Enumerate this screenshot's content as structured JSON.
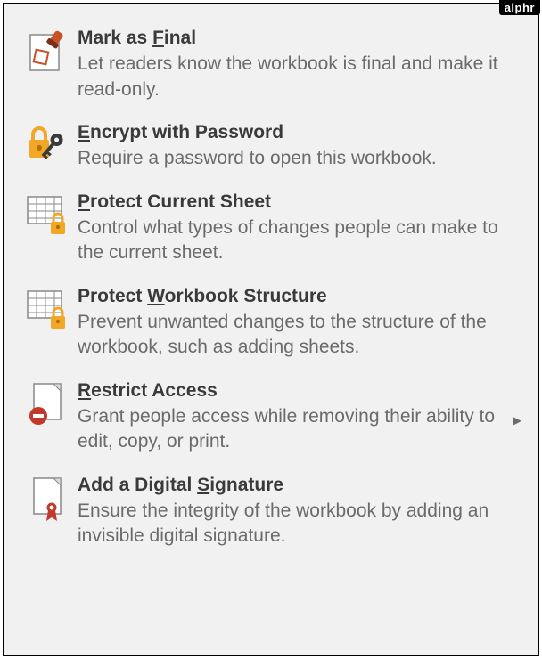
{
  "watermark": "alphr",
  "menu": {
    "items": [
      {
        "id": "mark-as-final",
        "title_pre": "Mark as ",
        "title_mnemonic": "F",
        "title_post": "inal",
        "desc": "Let readers know the workbook is final and make it read-only.",
        "has_submenu": false
      },
      {
        "id": "encrypt-with-password",
        "title_pre": "",
        "title_mnemonic": "E",
        "title_post": "ncrypt with Password",
        "desc": "Require a password to open this workbook.",
        "has_submenu": false
      },
      {
        "id": "protect-current-sheet",
        "title_pre": "",
        "title_mnemonic": "P",
        "title_post": "rotect Current Sheet",
        "desc": "Control what types of changes people can make to the current sheet.",
        "has_submenu": false
      },
      {
        "id": "protect-workbook-structure",
        "title_pre": "Protect ",
        "title_mnemonic": "W",
        "title_post": "orkbook Structure",
        "desc": "Prevent unwanted changes to the structure of the workbook, such as adding sheets.",
        "has_submenu": false
      },
      {
        "id": "restrict-access",
        "title_pre": "",
        "title_mnemonic": "R",
        "title_post": "estrict Access",
        "desc": "Grant people access while removing their ability to edit, copy, or print.",
        "has_submenu": true
      },
      {
        "id": "add-digital-signature",
        "title_pre": "Add a Digital ",
        "title_mnemonic": "S",
        "title_post": "ignature",
        "desc": "Ensure the integrity of the workbook by adding an invisible digital signature.",
        "has_submenu": false
      }
    ]
  }
}
